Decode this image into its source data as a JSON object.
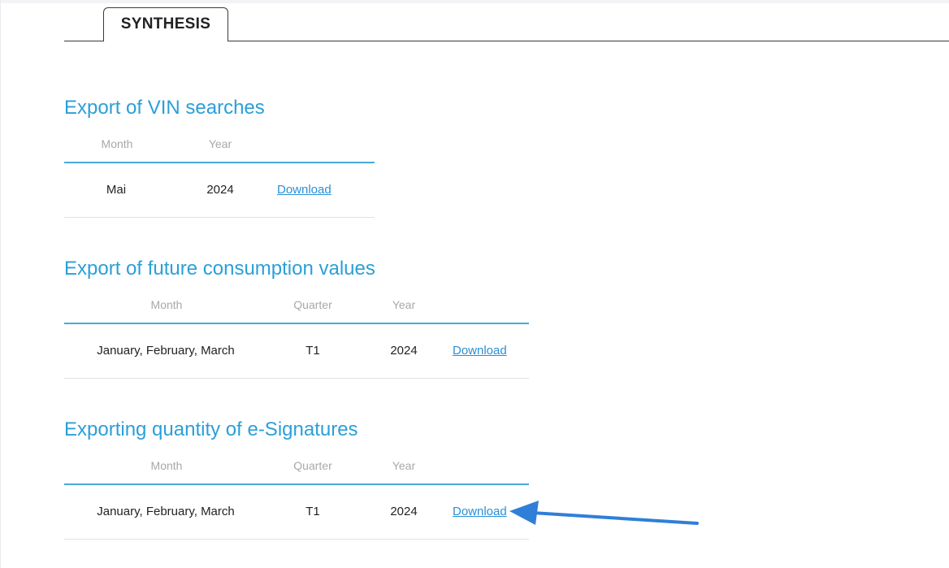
{
  "tabs": {
    "active_label": "SYNTHESIS"
  },
  "vin": {
    "title": "Export of VIN searches",
    "headers": {
      "month": "Month",
      "year": "Year"
    },
    "row": {
      "month": "Mai",
      "year": "2024",
      "action": "Download"
    }
  },
  "future": {
    "title": "Export of future consumption values",
    "headers": {
      "month": "Month",
      "quarter": "Quarter",
      "year": "Year"
    },
    "row": {
      "month": "January, February, March",
      "quarter": "T1",
      "year": "2024",
      "action": "Download"
    }
  },
  "esign": {
    "title": "Exporting quantity of e-Signatures",
    "headers": {
      "month": "Month",
      "quarter": "Quarter",
      "year": "Year"
    },
    "row": {
      "month": "January, February, March",
      "quarter": "T1",
      "year": "2024",
      "action": "Download"
    }
  },
  "colors": {
    "accent": "#2b9fd8",
    "link": "#2a8fd6",
    "annotation_arrow": "#2f7fd8"
  }
}
